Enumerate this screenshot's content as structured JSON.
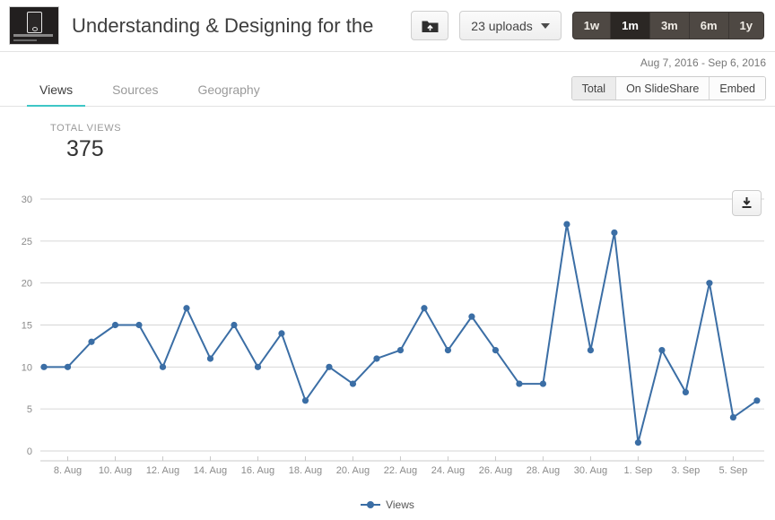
{
  "header": {
    "doc_title": "Understanding & Designing for the",
    "thumbnail_alt": "presentation-thumbnail",
    "upload_button_icon": "upload-folder-icon",
    "uploads_label": "23 uploads",
    "range_buttons": [
      {
        "label": "1w",
        "active": false
      },
      {
        "label": "1m",
        "active": true
      },
      {
        "label": "3m",
        "active": false
      },
      {
        "label": "6m",
        "active": false
      },
      {
        "label": "1y",
        "active": false
      }
    ],
    "date_range": "Aug 7, 2016 - Sep 6, 2016"
  },
  "tabs": [
    {
      "label": "Views",
      "active": true
    },
    {
      "label": "Sources",
      "active": false
    },
    {
      "label": "Geography",
      "active": false
    }
  ],
  "segments": [
    {
      "label": "Total",
      "active": true
    },
    {
      "label": "On SlideShare",
      "active": false
    },
    {
      "label": "Embed",
      "active": false
    }
  ],
  "totals": {
    "label": "TOTAL VIEWS",
    "value": "375"
  },
  "chart_toolbar": {
    "download_icon": "download-icon"
  },
  "colors": {
    "series": "#3b6ea5",
    "grid": "#cccccc",
    "tab_accent": "#3ec6c6",
    "axis_text": "#8a8a8a"
  },
  "chart_data": {
    "type": "line",
    "title": "",
    "xlabel": "",
    "ylabel": "",
    "ylim": [
      0,
      30
    ],
    "yticks": [
      0,
      5,
      10,
      15,
      20,
      25,
      30
    ],
    "grid": true,
    "legend": [
      "Views"
    ],
    "legend_position": "bottom",
    "x": [
      "7. Aug",
      "8. Aug",
      "9. Aug",
      "10. Aug",
      "11. Aug",
      "12. Aug",
      "13. Aug",
      "14. Aug",
      "15. Aug",
      "16. Aug",
      "17. Aug",
      "18. Aug",
      "19. Aug",
      "20. Aug",
      "21. Aug",
      "22. Aug",
      "23. Aug",
      "24. Aug",
      "25. Aug",
      "26. Aug",
      "27. Aug",
      "28. Aug",
      "29. Aug",
      "30. Aug",
      "31. Aug",
      "1. Sep",
      "2. Sep",
      "3. Sep",
      "4. Sep",
      "5. Sep",
      "6. Sep"
    ],
    "xtick_labels": [
      "8. Aug",
      "10. Aug",
      "12. Aug",
      "14. Aug",
      "16. Aug",
      "18. Aug",
      "20. Aug",
      "22. Aug",
      "24. Aug",
      "26. Aug",
      "28. Aug",
      "30. Aug",
      "1. Sep",
      "3. Sep",
      "5. Sep"
    ],
    "series": [
      {
        "name": "Views",
        "color": "#3b6ea5",
        "values": [
          10,
          10,
          13,
          15,
          15,
          10,
          17,
          11,
          15,
          10,
          14,
          6,
          10,
          8,
          11,
          12,
          17,
          12,
          16,
          12,
          8,
          8,
          27,
          12,
          26,
          1,
          12,
          7,
          20,
          4,
          6
        ]
      }
    ]
  }
}
